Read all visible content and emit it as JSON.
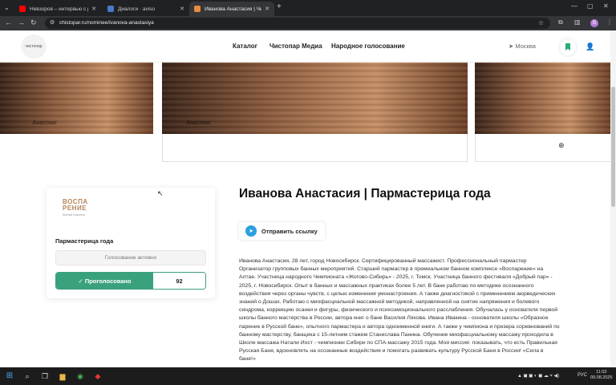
{
  "browser": {
    "tabs": [
      {
        "label": "Невзоров – интервью с p",
        "favicon_color": "#ff0000",
        "active": false
      },
      {
        "label": "Диалоги · aviso",
        "favicon_color": "#4a79c9",
        "active": false
      },
      {
        "label": "Иванова Анастасия | Чистопар",
        "favicon_color": "#e88b3d",
        "active": true
      }
    ],
    "new_tab": "+",
    "url": "chistopar.ru/nominee/ivanova-anastasiya"
  },
  "site": {
    "logo_text": "чистопар",
    "nav": [
      "Каталог",
      "Чистопар Медиа",
      "Народное голосование"
    ],
    "city": "Москва"
  },
  "photos": {
    "caption": "Анастас"
  },
  "card": {
    "brand_line1": "ВОСПА",
    "brand_line2": "РЕНИЕ",
    "brand_sub": "банный комплекс",
    "category": "Пармастерица года",
    "status": "Голосование активно",
    "vote_label": "✓ Проголосовано",
    "vote_count": "92"
  },
  "main": {
    "title": "Иванова Анастасия | Пармастерица года",
    "share_label": "Отправить ссылку",
    "bio": "Иванова Анастасия, 28 лет, город Новосибирск. Сертифицированный массажист. Профессиональный пармастер Организатор групповых банных мероприятий. Старший пармастер в премиальном банном комплексе «Воспарение» на Алтае. Участница народного Чемпионата «Жогово-Сибирь» - 2025, г. Томск. Участница банного фестиваля «Добрый пар» - 2025, г. Новосибирск. Опыт в банных и массажных практиках более 5 лет. В бане работаю по методике осознанного воздействия через органы чувств, с целью изменения умонастроения. А также диагностикой с применением аюрведических знаний о Дошах. Работаю с миофасциальной массажной методикой, направленной на снятие напряжения и болевого синдрома, коррекцию осанки и фигуры, физического и психоэмоционального расслабления. Обучалась у основателя первой школы банного мастерства в России, автора книг о бане Василия Ляхова. Ивана Ивакина - основателя школы «Образное парение в Русской бане», опытного пармастера и автора одноименной книги. А также у чемпиона и призера соревнований по банному мастерству, банщика с 15-летним стажем Станислава Панина. Обучение миофасциальному массажу проходила в Школе массажа Натали Иост - чемпионки Сибири по СПА-массажу 2015 года. Моя миссия: показывать, что есть Правильная Русская Баня, вдохновлять на осознанные воздействия и помогать развивать культуру Русской Бани в России! «Сила в бане!»"
  },
  "taskbar": {
    "lang": "РУС",
    "time": "11:02",
    "date": "09.08.2025"
  },
  "colors": {
    "accent_green": "#3aa17d",
    "telegram_blue": "#2ba0e0",
    "brand_gold": "#b58558"
  }
}
